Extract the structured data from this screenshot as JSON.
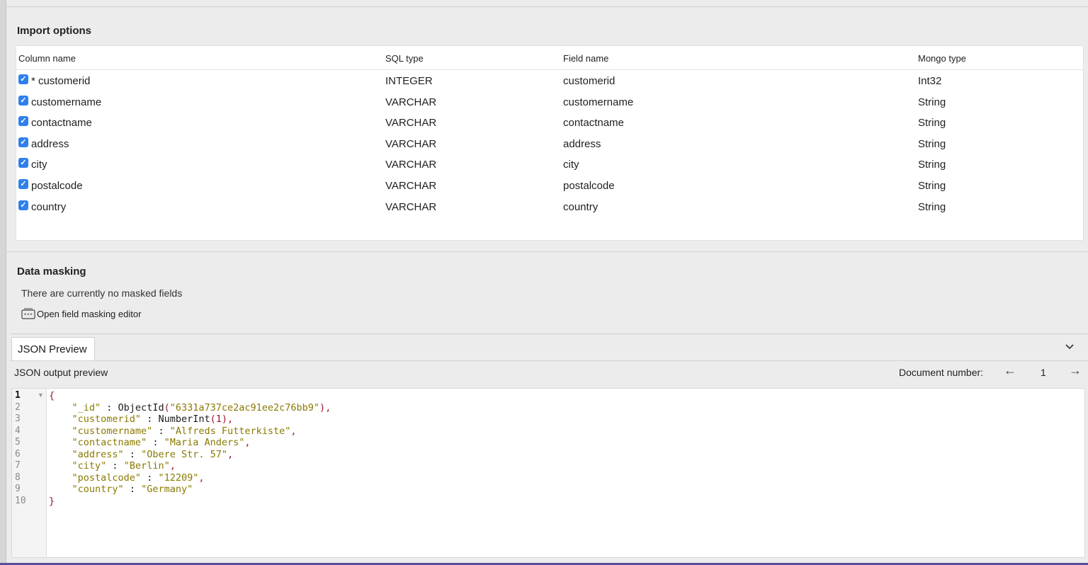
{
  "import_options": {
    "title": "Import options",
    "headers": {
      "column_name": "Column name",
      "sql_type": "SQL type",
      "field_name": "Field name",
      "mongo_type": "Mongo type"
    },
    "rows": [
      {
        "column": "* customerid",
        "sql": "INTEGER",
        "field": "customerid",
        "mongo": "Int32",
        "checked": true
      },
      {
        "column": "customername",
        "sql": "VARCHAR",
        "field": "customername",
        "mongo": "String",
        "checked": true
      },
      {
        "column": "contactname",
        "sql": "VARCHAR",
        "field": "contactname",
        "mongo": "String",
        "checked": true
      },
      {
        "column": "address",
        "sql": "VARCHAR",
        "field": "address",
        "mongo": "String",
        "checked": true
      },
      {
        "column": "city",
        "sql": "VARCHAR",
        "field": "city",
        "mongo": "String",
        "checked": true
      },
      {
        "column": "postalcode",
        "sql": "VARCHAR",
        "field": "postalcode",
        "mongo": "String",
        "checked": true
      },
      {
        "column": "country",
        "sql": "VARCHAR",
        "field": "country",
        "mongo": "String",
        "checked": true
      }
    ]
  },
  "data_masking": {
    "title": "Data masking",
    "status": "There are currently no masked fields",
    "open_editor_label": "Open field masking editor"
  },
  "json_preview": {
    "tab_label": "JSON Preview",
    "output_label": "JSON output preview",
    "document_number_label": "Document number:",
    "document_number": "1",
    "prev_arrow": "←",
    "next_arrow": "→",
    "line_numbers": [
      "1",
      "2",
      "3",
      "4",
      "5",
      "6",
      "7",
      "8",
      "9",
      "10"
    ],
    "code": {
      "open_brace": "{",
      "id_key": "\"_id\"",
      "id_func": "ObjectId",
      "id_value": "\"6331a737ce2ac91ee2c76bb9\"",
      "customerid_key": "\"customerid\"",
      "customerid_func": "NumberInt",
      "customerid_value": "1",
      "customername_key": "\"customername\"",
      "customername_value": "\"Alfreds Futterkiste\"",
      "contactname_key": "\"contactname\"",
      "contactname_value": "\"Maria Anders\"",
      "address_key": "\"address\"",
      "address_value": "\"Obere Str. 57\"",
      "city_key": "\"city\"",
      "city_value": "\"Berlin\"",
      "postalcode_key": "\"postalcode\"",
      "postalcode_value": "\"12209\"",
      "country_key": "\"country\"",
      "country_value": "\"Germany\"",
      "close_brace": "}"
    }
  },
  "colors": {
    "checkbox": "#2f80ed",
    "json_string": "#8a7a00",
    "json_punct": "#a0162c",
    "accent_bottom": "#5b4f9a"
  }
}
